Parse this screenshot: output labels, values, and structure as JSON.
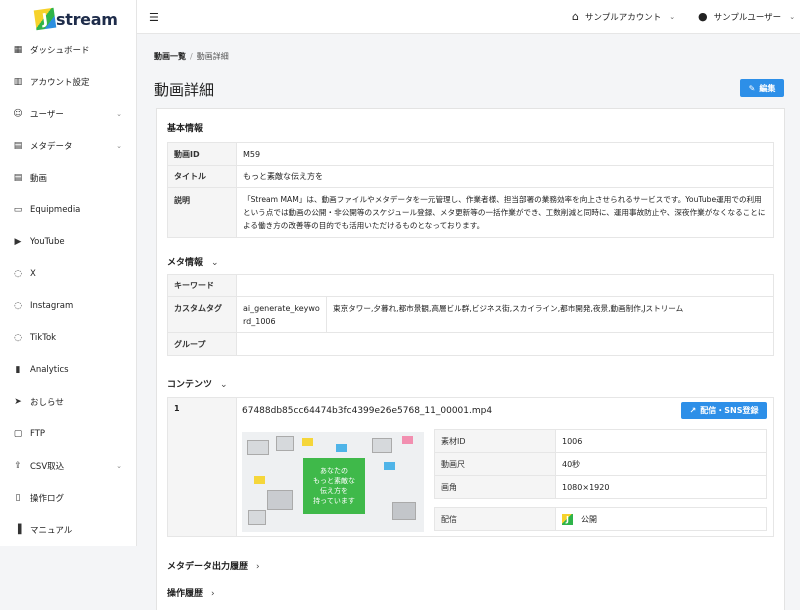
{
  "logo": {
    "letter": "J",
    "text": "stream"
  },
  "sidebar": {
    "items": [
      {
        "label": "ダッシュボード",
        "icon": "grid-icon"
      },
      {
        "label": "アカウント設定",
        "icon": "building-icon"
      },
      {
        "label": "ユーザー",
        "icon": "user-icon",
        "chevron": true
      },
      {
        "label": "メタデータ",
        "icon": "film-icon",
        "chevron": true
      },
      {
        "label": "動画",
        "icon": "film-icon"
      },
      {
        "label": "Equipmedia",
        "icon": "camera-icon"
      },
      {
        "label": "YouTube",
        "icon": "play-circle-icon"
      },
      {
        "label": "X",
        "icon": "chat-icon"
      },
      {
        "label": "Instagram",
        "icon": "chat-icon"
      },
      {
        "label": "TikTok",
        "icon": "chat-icon"
      },
      {
        "label": "Analytics",
        "icon": "bar-chart-icon"
      },
      {
        "label": "おしらせ",
        "icon": "send-icon"
      },
      {
        "label": "FTP",
        "icon": "folder-icon"
      },
      {
        "label": "CSV取込",
        "icon": "upload-icon",
        "chevron": true
      },
      {
        "label": "操作ログ",
        "icon": "document-icon"
      },
      {
        "label": "マニュアル",
        "icon": "book-icon"
      }
    ]
  },
  "topbar": {
    "account": "サンプルアカウント",
    "user": "サンプルユーザー"
  },
  "breadcrumb": {
    "parent": "動画一覧",
    "separator": "/",
    "current": "動画詳細"
  },
  "page": {
    "title": "動画詳細",
    "edit_label": "編集"
  },
  "basic": {
    "heading": "基本情報",
    "rows": [
      {
        "key": "動画ID",
        "value": "M59"
      },
      {
        "key": "タイトル",
        "value": "もっと素敵な伝え方を"
      },
      {
        "key": "説明",
        "value": "「Stream MAM」は、動画ファイルやメタデータを一元管理し、作業者様、担当部署の業務効率を向上させられるサービスです。YouTube運用での利用という点では動画の公開・非公開等のスケジュール登録、メタ更新等の一括作業ができ、工数削減と同時に、運用事故防止や、深夜作業がなくなることによる働き方の改善等の目的でも活用いただけるものとなっております。"
      }
    ]
  },
  "meta": {
    "heading": "メタ情報",
    "keyword_label": "キーワード",
    "keyword_value": "",
    "custom_label": "カスタムタグ",
    "custom_key": "ai_generate_keyword_1006",
    "custom_value": "東京タワー,夕暮れ,都市景観,高層ビル群,ビジネス街,スカイライン,都市開発,夜景,動画制作,Jストリーム",
    "group_label": "グループ",
    "group_value": ""
  },
  "contents": {
    "heading": "コンテンツ",
    "index": "1",
    "filename": "67488db85cc64474b3fc4399e26e5768_11_00001.mp4",
    "publish_label": "配信・SNS登録",
    "thumb_caption": [
      "あなたの",
      "もっと素敵な",
      "伝え方を",
      "持っています"
    ],
    "rows": [
      {
        "key": "素材ID",
        "value": "1006"
      },
      {
        "key": "動画尺",
        "value": "40秒"
      },
      {
        "key": "画角",
        "value": "1080×1920"
      }
    ],
    "delivery_label": "配信",
    "delivery_status": "公開"
  },
  "sections": {
    "export_history": "メタデータ出力履歴",
    "operation_history": "操作履歴"
  },
  "colors": {
    "accent": "#2d8fe8",
    "brand_green": "#3fb94a",
    "brand_yellow": "#f6d22b"
  }
}
